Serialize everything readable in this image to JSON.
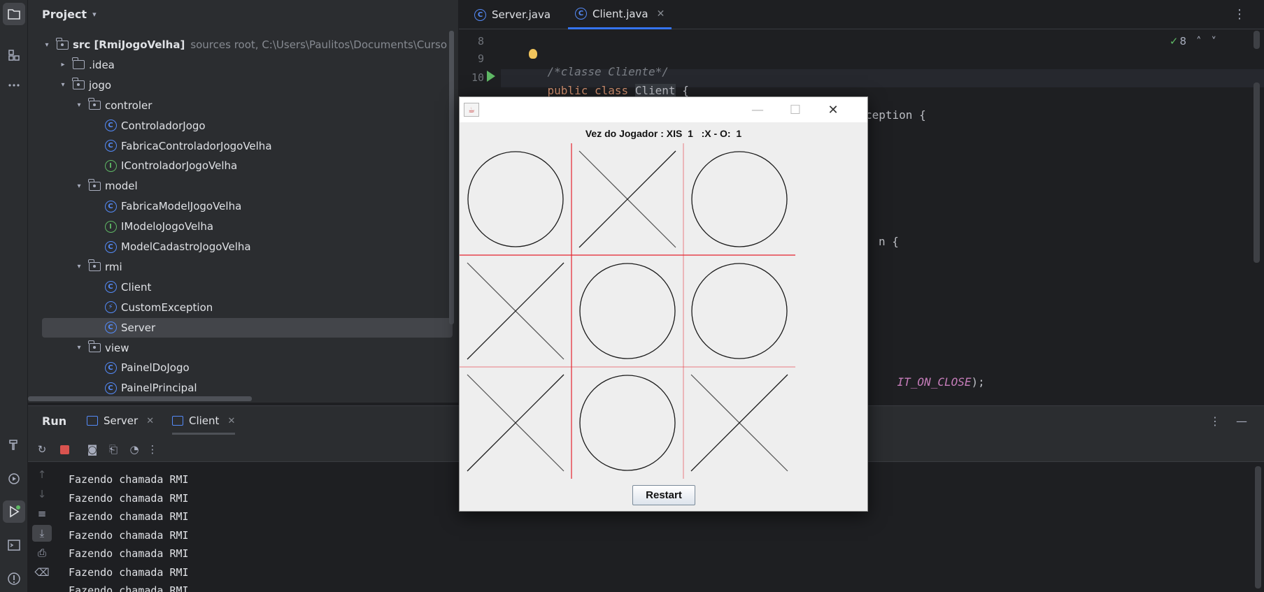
{
  "project": {
    "title": "Project",
    "tree": [
      {
        "level": 0,
        "expanded": true,
        "type": "root",
        "label": "src [RmiJogoVelha]",
        "hint": "sources root,  C:\\Users\\Paulitos\\Documents\\Curso"
      },
      {
        "level": 1,
        "expanded": false,
        "type": "folder",
        "label": ".idea"
      },
      {
        "level": 1,
        "expanded": true,
        "type": "package",
        "label": "jogo"
      },
      {
        "level": 2,
        "expanded": true,
        "type": "package",
        "label": "controler"
      },
      {
        "level": 3,
        "type": "class",
        "label": "ControladorJogo"
      },
      {
        "level": 3,
        "type": "class",
        "label": "FabricaControladorJogoVelha"
      },
      {
        "level": 3,
        "type": "interface",
        "label": "IControladorJogoVelha"
      },
      {
        "level": 2,
        "expanded": true,
        "type": "package",
        "label": "model"
      },
      {
        "level": 3,
        "type": "class",
        "label": "FabricaModelJogoVelha"
      },
      {
        "level": 3,
        "type": "interface",
        "label": "IModeloJogoVelha"
      },
      {
        "level": 3,
        "type": "class",
        "label": "ModelCadastroJogoVelha"
      },
      {
        "level": 2,
        "expanded": true,
        "type": "package",
        "label": "rmi"
      },
      {
        "level": 3,
        "type": "class",
        "label": "Client"
      },
      {
        "level": 3,
        "type": "exception",
        "label": "CustomException"
      },
      {
        "level": 3,
        "type": "class",
        "label": "Server",
        "selected": true
      },
      {
        "level": 2,
        "expanded": true,
        "type": "package",
        "label": "view"
      },
      {
        "level": 3,
        "type": "class",
        "label": "PainelDoJogo"
      },
      {
        "level": 3,
        "type": "class",
        "label": "PainelPrincipal"
      }
    ]
  },
  "editor": {
    "tabs": [
      {
        "label": "Server.java",
        "active": false
      },
      {
        "label": "Client.java",
        "active": true
      }
    ],
    "inspection_count": "8",
    "line_numbers": [
      "8",
      "9",
      "10"
    ],
    "code": {
      "line9_comment": "/*classe Cliente*/",
      "line10_kw": "public class ",
      "line10_name": "Client",
      "line10_brace": " {",
      "frag_exception": "ception {",
      "frag_n": "n {",
      "frag_close_const": "IT_ON_CLOSE",
      "frag_close_tail": ");"
    }
  },
  "run": {
    "title": "Run",
    "tabs": [
      {
        "label": "Server",
        "active": false
      },
      {
        "label": "Client",
        "active": true
      }
    ],
    "console": [
      "Fazendo chamada RMI",
      "Fazendo chamada RMI",
      "Fazendo chamada RMI",
      "Fazendo chamada RMI",
      "Fazendo chamada RMI",
      "Fazendo chamada RMI",
      "Fazendo chamada RMI"
    ]
  },
  "game": {
    "status": "Vez do Jogador : XIS  1   :X - O:  1",
    "board": [
      [
        "O",
        "X",
        "O"
      ],
      [
        "X",
        "O",
        "O"
      ],
      [
        "X",
        "O",
        "X"
      ]
    ],
    "restart_label": "Restart",
    "grid_color": "#e5232d",
    "mark_color": "#1a1a1a"
  },
  "colors": {
    "accent": "#3574f0",
    "class_icon": "#548af7",
    "interface_icon": "#5fb865"
  }
}
